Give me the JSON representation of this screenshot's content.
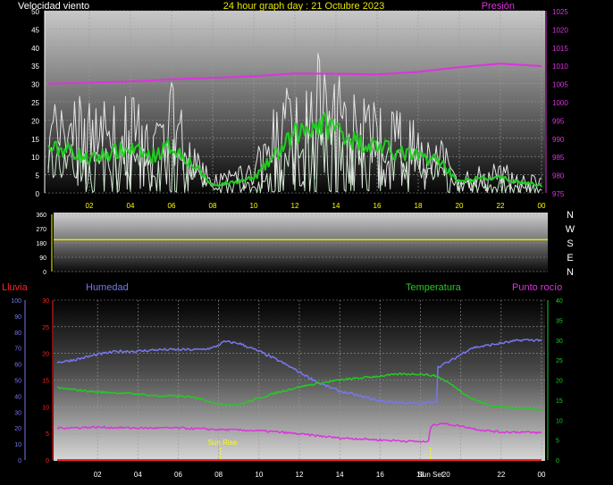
{
  "header": {
    "left_title": "Velocidad viento",
    "center_title": "24 hour graph day : 21 Octubre 2023",
    "right_title": "Presión"
  },
  "colors": {
    "white": "#ffffff",
    "pressure": "#dd33dd",
    "wind_avg": "#22cc22",
    "gust": "#e6e6e6",
    "wind_light": "#cfe8cf",
    "direction": "#e6e600",
    "rain": "#ff2222",
    "humidity": "#7777ee",
    "temperature": "#22cc22",
    "dewpoint": "#dd33dd",
    "tick_yellow": "#ffff00"
  },
  "chart_data": [
    {
      "type": "line",
      "panel": "wind-pressure",
      "y_left": {
        "ticks": [
          0,
          5,
          10,
          15,
          20,
          25,
          30,
          35,
          40,
          45,
          50
        ],
        "lim": [
          0,
          50
        ]
      },
      "y_right": {
        "ticks": [
          975,
          980,
          985,
          990,
          995,
          1000,
          1005,
          1010,
          1015,
          1020,
          1025
        ],
        "lim": [
          975,
          1025
        ]
      },
      "x_ticks": [
        "02",
        "04",
        "06",
        "08",
        "10",
        "12",
        "14",
        "16",
        "18",
        "20",
        "22",
        "00"
      ],
      "pressure": [
        [
          0,
          1005.0
        ],
        [
          2,
          1005.2
        ],
        [
          4,
          1005.6
        ],
        [
          6,
          1006.2
        ],
        [
          8,
          1006.6
        ],
        [
          10,
          1007.0
        ],
        [
          12,
          1007.8
        ],
        [
          14,
          1007.7
        ],
        [
          16,
          1007.5
        ],
        [
          18,
          1008.2
        ],
        [
          20,
          1009.5
        ],
        [
          22,
          1010.5
        ],
        [
          24,
          1009.8
        ]
      ],
      "wind_avg": [
        [
          0,
          12
        ],
        [
          1,
          12
        ],
        [
          2,
          9
        ],
        [
          3,
          11
        ],
        [
          4,
          12
        ],
        [
          5,
          10
        ],
        [
          6,
          13
        ],
        [
          7,
          8
        ],
        [
          8,
          2
        ],
        [
          9,
          3
        ],
        [
          10,
          4
        ],
        [
          11,
          10
        ],
        [
          12,
          16
        ],
        [
          13,
          19
        ],
        [
          14,
          18
        ],
        [
          15,
          14
        ],
        [
          16,
          13
        ],
        [
          17,
          11
        ],
        [
          18,
          10
        ],
        [
          19,
          9
        ],
        [
          20,
          3
        ],
        [
          21,
          4
        ],
        [
          22,
          4
        ],
        [
          23,
          3
        ],
        [
          24,
          2
        ]
      ],
      "gust": [
        [
          0,
          22
        ],
        [
          1,
          30
        ],
        [
          2,
          24
        ],
        [
          3,
          26
        ],
        [
          4,
          27
        ],
        [
          5,
          18
        ],
        [
          6,
          30
        ],
        [
          7,
          14
        ],
        [
          8,
          5
        ],
        [
          9,
          7
        ],
        [
          10,
          8
        ],
        [
          11,
          26
        ],
        [
          12,
          33
        ],
        [
          13,
          38
        ],
        [
          14,
          32
        ],
        [
          15,
          27
        ],
        [
          16,
          25
        ],
        [
          17,
          22
        ],
        [
          18,
          21
        ],
        [
          19,
          17
        ],
        [
          20,
          5
        ],
        [
          21,
          7
        ],
        [
          22,
          8
        ],
        [
          23,
          6
        ],
        [
          24,
          4
        ]
      ]
    },
    {
      "type": "line",
      "panel": "wind-direction",
      "y_ticks": [
        0,
        90,
        180,
        270,
        360
      ],
      "ylim": [
        0,
        360
      ],
      "compass_labels": [
        "N",
        "W",
        "S",
        "E",
        "N"
      ],
      "direction": [
        [
          0,
          200
        ],
        [
          24,
          200
        ]
      ]
    },
    {
      "type": "line",
      "panel": "humidity-temperature",
      "series_labels": {
        "rain": "Lluvia",
        "humidity": "Humedad",
        "temperature": "Temperatura",
        "dewpoint": "Punto rocío"
      },
      "y_humidity": {
        "ticks": [
          0,
          10,
          20,
          30,
          40,
          50,
          60,
          70,
          80,
          90,
          100
        ],
        "lim": [
          0,
          100
        ]
      },
      "y_rain": {
        "ticks": [
          0,
          5,
          10,
          15,
          20,
          25,
          30
        ],
        "lim": [
          0,
          30
        ]
      },
      "y_temp": {
        "ticks": [
          0,
          5,
          10,
          15,
          20,
          25,
          30,
          35,
          40
        ],
        "lim": [
          0,
          40
        ]
      },
      "x_ticks": [
        "02",
        "04",
        "06",
        "08",
        "10",
        "12",
        "14",
        "16",
        "18",
        "20",
        "22",
        "00"
      ],
      "events": [
        {
          "label": "Sun Rise",
          "hour": 8.1
        },
        {
          "label": "Sun Set",
          "hour": 18.5
        }
      ],
      "humidity": [
        [
          0,
          61
        ],
        [
          1,
          63
        ],
        [
          2,
          66
        ],
        [
          3,
          68
        ],
        [
          4,
          68
        ],
        [
          5,
          69
        ],
        [
          6,
          69
        ],
        [
          7,
          69
        ],
        [
          7.7,
          70
        ],
        [
          8.3,
          74
        ],
        [
          9,
          73
        ],
        [
          10,
          68
        ],
        [
          11,
          62
        ],
        [
          12,
          55
        ],
        [
          13,
          48
        ],
        [
          14,
          43
        ],
        [
          15,
          40
        ],
        [
          16,
          37
        ],
        [
          17,
          36
        ],
        [
          18,
          35
        ],
        [
          18.8,
          37
        ],
        [
          18.85,
          58
        ],
        [
          19.5,
          62
        ],
        [
          20.5,
          70
        ],
        [
          21.5,
          72
        ],
        [
          23,
          75
        ],
        [
          24,
          75
        ]
      ],
      "temperature": [
        [
          0,
          18
        ],
        [
          1,
          17.5
        ],
        [
          2,
          17
        ],
        [
          3,
          16.8
        ],
        [
          4,
          16.5
        ],
        [
          5,
          16
        ],
        [
          6,
          16
        ],
        [
          7,
          15.5
        ],
        [
          8,
          14
        ],
        [
          9,
          13.8
        ],
        [
          10,
          15.5
        ],
        [
          11,
          17
        ],
        [
          12,
          18.3
        ],
        [
          13,
          19.2
        ],
        [
          14,
          20
        ],
        [
          15,
          20.5
        ],
        [
          16,
          21
        ],
        [
          17,
          21.5
        ],
        [
          18,
          21.5
        ],
        [
          18.8,
          21
        ],
        [
          19.5,
          19
        ],
        [
          20.5,
          15.5
        ],
        [
          21.5,
          13.5
        ],
        [
          23,
          13
        ],
        [
          24,
          12.5
        ]
      ],
      "dewpoint": [
        [
          0,
          8
        ],
        [
          2,
          8.2
        ],
        [
          4,
          8
        ],
        [
          6,
          8
        ],
        [
          7,
          7.8
        ],
        [
          8,
          7.6
        ],
        [
          9,
          7.5
        ],
        [
          10,
          7.3
        ],
        [
          11,
          7
        ],
        [
          12,
          6.5
        ],
        [
          13,
          6
        ],
        [
          14,
          5.5
        ],
        [
          15,
          5.3
        ],
        [
          16,
          5
        ],
        [
          17,
          4.8
        ],
        [
          18.4,
          4.5
        ],
        [
          18.5,
          8.5
        ],
        [
          19,
          9.2
        ],
        [
          20,
          8.5
        ],
        [
          21,
          7.5
        ],
        [
          22,
          7
        ],
        [
          23,
          7
        ],
        [
          24,
          6.8
        ]
      ],
      "rain": [
        [
          0,
          0
        ],
        [
          24,
          0
        ]
      ]
    }
  ]
}
